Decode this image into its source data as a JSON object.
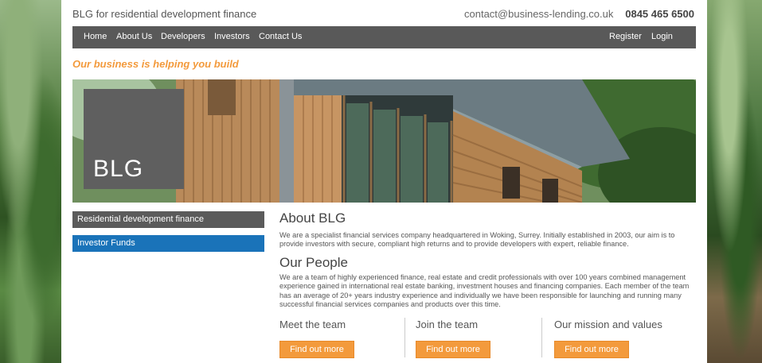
{
  "header": {
    "site_title": "BLG for residential development finance",
    "email": "contact@business-lending.co.uk",
    "phone": "0845 465 6500"
  },
  "nav": {
    "items": [
      "Home",
      "About Us",
      "Developers",
      "Investors",
      "Contact Us"
    ],
    "register": "Register",
    "login": "Login"
  },
  "tagline": "Our business is helping you build",
  "hero": {
    "logo": "BLG"
  },
  "sidebar": {
    "items": [
      "Residential development finance",
      "Investor Funds"
    ]
  },
  "about": {
    "title": "About BLG",
    "text": "We are a specialist financial services company headquartered in Woking, Surrey. Initially established in 2003, our aim is to provide investors with secure, compliant high returns and to provide developers with expert, reliable finance."
  },
  "people": {
    "title": "Our People",
    "text": "We are a team of highly experienced finance, real estate and credit professionals with over 100 years combined management experience gained in international real estate banking, investment houses and financing companies. Each member of the team has an average of 20+ years industry experience and individually we have been responsible for launching and running many successful financial services companies and products over this time."
  },
  "columns": [
    {
      "title": "Meet the team",
      "button": "Find out more"
    },
    {
      "title": "Join the team",
      "button": "Find out more"
    },
    {
      "title": "Our mission and values",
      "button": "Find out more"
    }
  ],
  "colors": {
    "accent": "#f39a3c",
    "nav_bg": "#595959",
    "active_blue": "#1a73b9"
  }
}
